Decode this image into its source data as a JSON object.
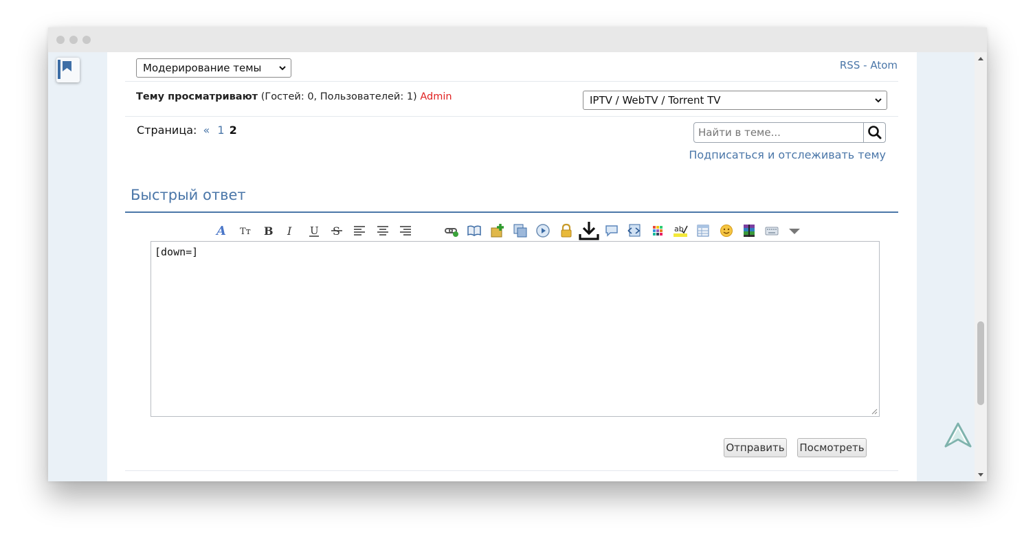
{
  "moderation": {
    "selected": "Модерирование темы"
  },
  "feeds": {
    "rss": "RSS",
    "separator": "-",
    "atom": "Atom"
  },
  "viewers": {
    "label": "Тему просматривают",
    "counts": "(Гостей: 0, Пользователей: 1)",
    "user": "Admin"
  },
  "forum_jump": {
    "selected": "IPTV / WebTV / Torrent TV"
  },
  "pagination": {
    "label": "Страница:",
    "prev": "«",
    "page1": "1",
    "current": "2"
  },
  "search": {
    "placeholder": "Найти в теме..."
  },
  "subscribe": {
    "label": "Подписаться и отслеживать тему"
  },
  "quick_reply": {
    "title": "Быстрый ответ"
  },
  "editor": {
    "content": "[down=]"
  },
  "toolbar": {
    "icons": [
      "font-color-icon",
      "font-size-icon",
      "bold-icon",
      "italic-icon",
      "underline-icon",
      "strikethrough-icon",
      "align-left-icon",
      "align-center-icon",
      "align-right-icon",
      "link-icon",
      "book-icon",
      "add-image-icon",
      "copy-icon",
      "play-icon",
      "lock-icon",
      "download-icon",
      "speech-bubble-icon",
      "code-icon",
      "color-grid-icon",
      "spellcheck-icon",
      "table-icon",
      "smiley-icon",
      "archive-icon",
      "keyboard-icon",
      "more-dropdown-icon"
    ]
  },
  "actions": {
    "submit": "Отправить",
    "preview": "Посмотреть"
  },
  "colors": {
    "accent": "#4a76a8",
    "admin": "#e02020",
    "page_bg": "#eaf1f7"
  }
}
